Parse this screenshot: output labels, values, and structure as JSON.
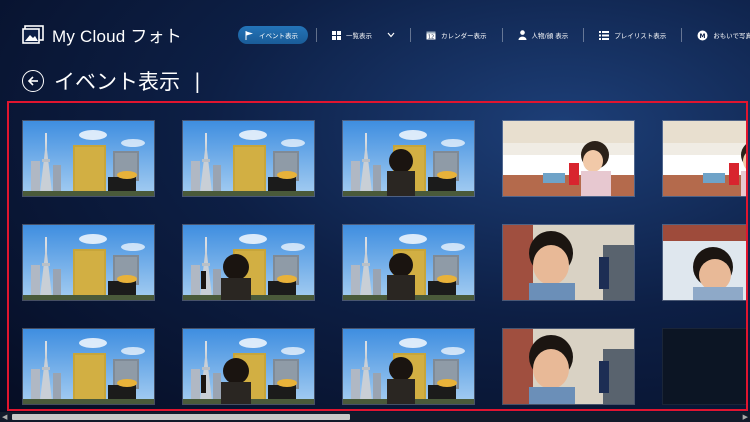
{
  "app": {
    "title": "My Cloud フォト"
  },
  "nav": {
    "items": [
      {
        "id": "event",
        "label": "イベント表示",
        "icon": "flag-icon",
        "active": true
      },
      {
        "id": "list",
        "label": "一覧表示",
        "icon": "grid-icon",
        "active": false
      },
      {
        "id": "calendar",
        "label": "カレンダー表示",
        "icon": "calendar-icon",
        "active": false
      },
      {
        "id": "people",
        "label": "人物/顔 表示",
        "icon": "person-icon",
        "active": false
      },
      {
        "id": "playlist",
        "label": "プレイリスト表示",
        "icon": "list-icon",
        "active": false
      },
      {
        "id": "memories",
        "label": "おもいで写真館",
        "icon": "memories-logo-icon",
        "active": false
      }
    ],
    "dropdown_icon": "chevron-down-icon"
  },
  "page": {
    "title": "イベント表示",
    "caret": "|"
  },
  "photos": [
    "tower-building",
    "tower-building",
    "tower-building-child",
    "restaurant-girl",
    "restaurant-girl",
    "tower-building",
    "tower-building-peace",
    "tower-building-child",
    "boy-closeup",
    "boy-window",
    "tower-building",
    "tower-building-peace",
    "tower-building-child",
    "boy-closeup",
    "empty"
  ],
  "colors": {
    "accent": "#2474b8",
    "selection_border": "#e0152f",
    "sky": "#5aa3e8",
    "gold_building": "#c7a53a"
  }
}
